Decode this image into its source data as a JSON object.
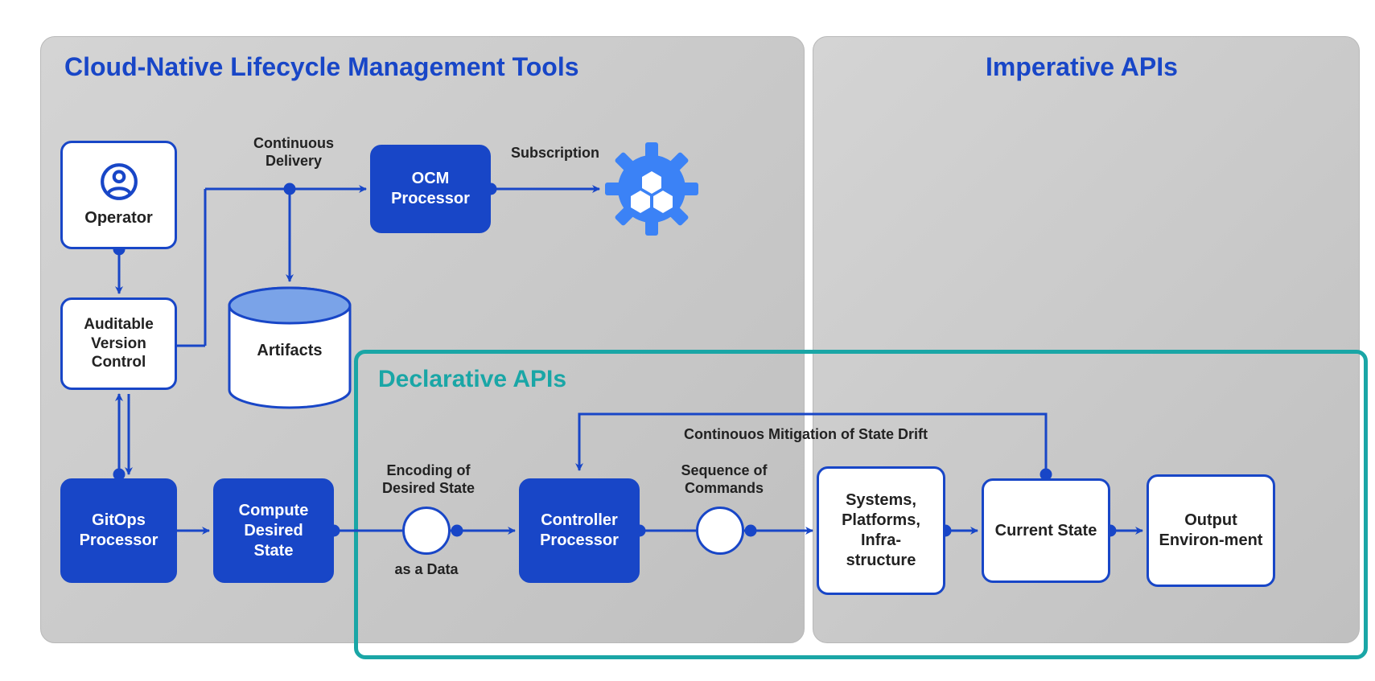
{
  "panels": {
    "cloud_native": {
      "title": "Cloud-Native Lifecycle Management Tools"
    },
    "imperative": {
      "title": "Imperative APIs"
    },
    "declarative": {
      "title": "Declarative APIs"
    }
  },
  "nodes": {
    "operator": {
      "label": "Operator"
    },
    "avc": {
      "label": "Auditable Version Control"
    },
    "artifacts": {
      "label": "Artifacts"
    },
    "ocm": {
      "label": "OCM Processor"
    },
    "gitops": {
      "label": "GitOps Processor"
    },
    "compute": {
      "label": "Compute Desired State"
    },
    "controller": {
      "label": "Controller Processor"
    },
    "systems": {
      "label": "Systems, Platforms, Infra-structure"
    },
    "current": {
      "label": "Current State"
    },
    "output": {
      "label": "Output Environ-ment"
    }
  },
  "labels": {
    "continuous_delivery": "Continuous Delivery",
    "subscription": "Subscription",
    "encoding_top": "Encoding of Desired State",
    "encoding_bottom": "as a Data",
    "sequence": "Sequence of Commands",
    "mitigation": "Continouos Mitigation of State Drift"
  },
  "colors": {
    "brand_blue": "#1846c7",
    "teal": "#1aa6a6",
    "light_blue": "#3b82f6"
  }
}
